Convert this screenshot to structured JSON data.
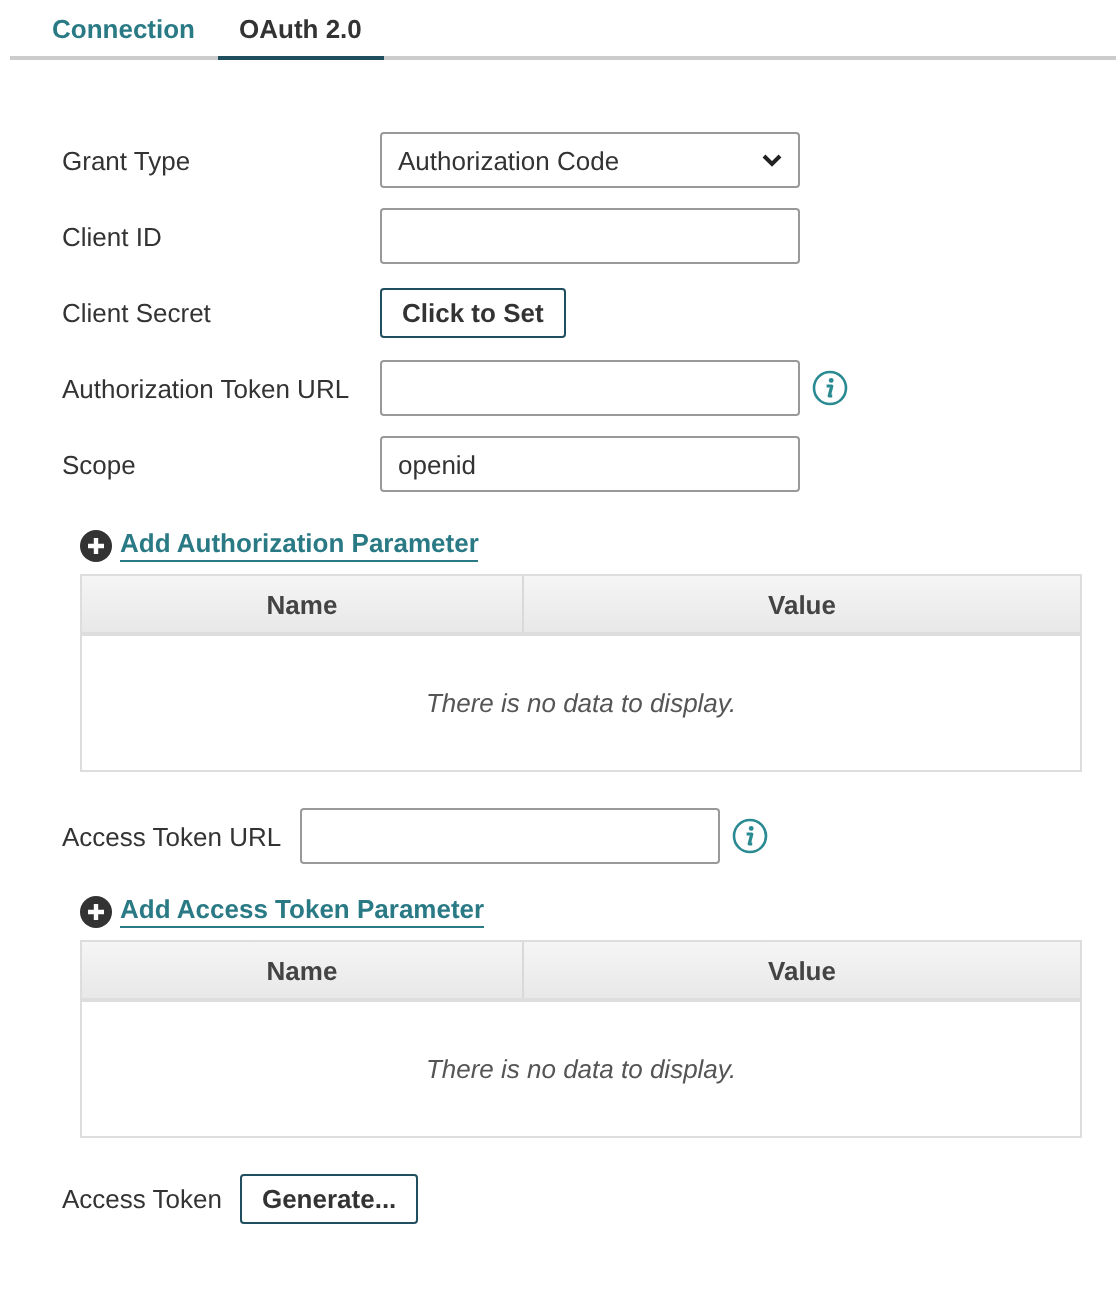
{
  "tabs": [
    {
      "label": "Connection",
      "selected": false
    },
    {
      "label": "OAuth 2.0",
      "selected": true
    }
  ],
  "fields": [
    {
      "kind": "select",
      "label": "Grant Type",
      "value": "Authorization Code"
    },
    {
      "kind": "text",
      "label": "Client ID"
    },
    {
      "kind": "button",
      "label": "Client Secret",
      "button": "Click to Set"
    },
    {
      "kind": "text",
      "label": "Authorization Token URL",
      "info": true
    },
    {
      "kind": "text",
      "label": "Scope",
      "value": "openid"
    }
  ],
  "authorization_parameters": {
    "add_link": "Add Authorization Parameter",
    "columns": [
      "Name",
      "Value"
    ],
    "empty_message": "There is no data to display."
  },
  "access_token_url": {
    "label": "Access Token URL",
    "info": true
  },
  "access_token_parameters": {
    "add_link": "Add Access Token Parameter",
    "columns": [
      "Name",
      "Value"
    ],
    "empty_message": "There is no data to display."
  },
  "access_token": {
    "label": "Access Token",
    "button": "Generate..."
  }
}
